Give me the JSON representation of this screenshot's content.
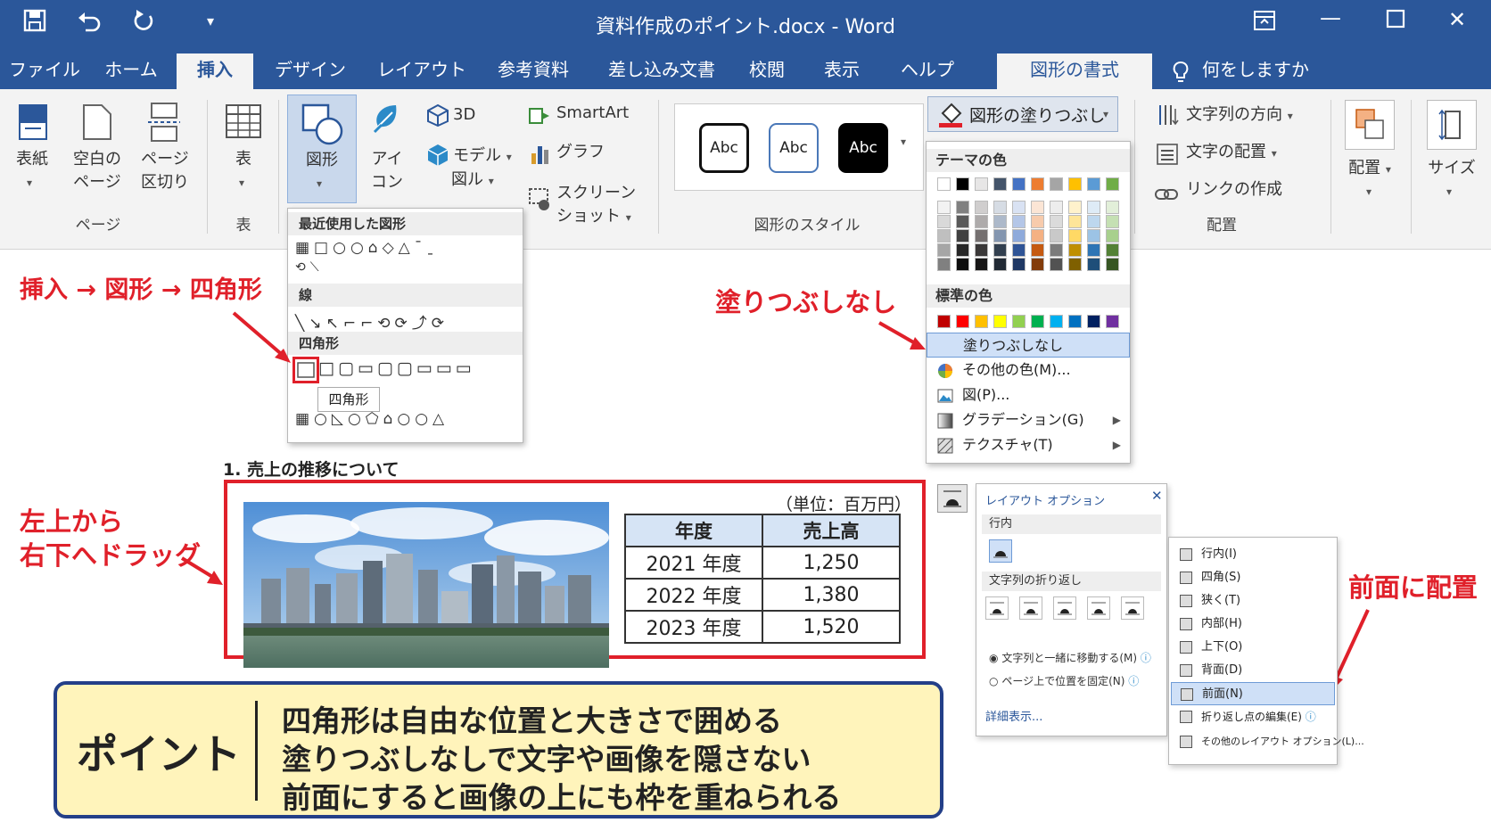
{
  "titlebar": {
    "title": "資料作成のポイント.docx  -  Word",
    "quick_access": [
      "save-icon",
      "undo-icon",
      "redo-icon",
      "customize-icon"
    ],
    "window_controls": [
      "ribbon-display-icon",
      "minimize-icon",
      "maximize-icon",
      "close-icon"
    ]
  },
  "tabs": [
    "ファイル",
    "ホーム",
    "挿入",
    "デザイン",
    "レイアウト",
    "参考資料",
    "差し込み文書",
    "校閲",
    "表示",
    "ヘルプ",
    "図形の書式",
    "何をしますか"
  ],
  "ribbon": {
    "cover": "表紙",
    "blank_page_1": "空白の",
    "blank_page_2": "ページ",
    "page_break_1": "ページ",
    "page_break_2": "区切り",
    "group_pages": "ページ",
    "table": "表",
    "group_table": "表",
    "shapes": "図形",
    "icons_1": "アイ",
    "icons_2": "コン",
    "threed": "3D",
    "model_1": "モデル",
    "model_2": "図ル",
    "smartart": "SmartArt",
    "graph": "グラフ",
    "screenshot_1": "スクリーン",
    "screenshot_2": "ショット",
    "style_samples": [
      "Abc",
      "Abc",
      "Abc"
    ],
    "group_styles": "図形のスタイル",
    "fill_button": "図形の塗りつぶし",
    "text_direction": "文字列の方向",
    "text_align": "文字の配置",
    "create_link": "リンクの作成",
    "group_text": "配置",
    "arrange": "配置",
    "size": "サイズ"
  },
  "shapes_pane": {
    "recent": "最近使用した図形",
    "lines": "線",
    "rectangles": "四角形",
    "recent_row1": "▦□○○⌂◇△ˉˍ",
    "recent_row2": "⟲⟍",
    "lines_row": "╲↘↖⌐⌐⟲⟳⤴⟳",
    "rect_row": "□▢▭▢▢▭▭▭",
    "tooltip": "四角形",
    "basic_row": "▦○◺○⬠⌂○○△"
  },
  "fill_pane": {
    "theme_colors": "テーマの色",
    "standard_colors": "標準の色",
    "theme_top": [
      "#ffffff",
      "#000000",
      "#e7e6e6",
      "#44546a",
      "#4472c4",
      "#ed7d31",
      "#a5a5a5",
      "#ffc000",
      "#5b9bd5",
      "#70ad47"
    ],
    "theme_shades": [
      [
        "#f2f2f2",
        "#808080",
        "#d0cece",
        "#d6dce4",
        "#d9e2f3",
        "#fbe5d5",
        "#ededed",
        "#fff2cc",
        "#deebf6",
        "#e2efd9"
      ],
      [
        "#d9d9d9",
        "#595959",
        "#aeabab",
        "#adb9ca",
        "#b4c6e7",
        "#f7cbac",
        "#dbdbdb",
        "#fee599",
        "#bdd7ee",
        "#c5e0b3"
      ],
      [
        "#bfbfbf",
        "#404040",
        "#757070",
        "#8496b0",
        "#8eaadb",
        "#f4b183",
        "#c9c9c9",
        "#ffd965",
        "#9cc3e5",
        "#a8d08d"
      ],
      [
        "#a6a6a6",
        "#262626",
        "#3a3838",
        "#323f4f",
        "#2f5496",
        "#c55a11",
        "#7b7b7b",
        "#bf8f00",
        "#2e75b5",
        "#538135"
      ],
      [
        "#808080",
        "#0d0d0d",
        "#171616",
        "#222a35",
        "#1f3864",
        "#833c0b",
        "#525252",
        "#7f6000",
        "#1e4e79",
        "#375623"
      ]
    ],
    "standard": [
      "#c00000",
      "#ff0000",
      "#ffc000",
      "#ffff00",
      "#92d050",
      "#00b050",
      "#00b0f0",
      "#0070c0",
      "#002060",
      "#7030a0"
    ],
    "no_fill": "塗りつぶしなし",
    "more_colors": "その他の色(M)...",
    "picture": "図(P)...",
    "gradient": "グラデーション(G)",
    "texture": "テクスチャ(T)"
  },
  "annotations": {
    "insert_path": "挿入 → 図形 → 四角形",
    "no_fill": "塗りつぶしなし",
    "drag_1": "左上から",
    "drag_2": "右下へドラッグ",
    "front": "前面に配置"
  },
  "document": {
    "heading": "1. 売上の推移について",
    "unit": "（単位：百万円）",
    "table": {
      "headers": [
        "年度",
        "売上高"
      ],
      "rows": [
        [
          "2021 年度",
          "1,250"
        ],
        [
          "2022 年度",
          "1,380"
        ],
        [
          "2023 年度",
          "1,520"
        ]
      ]
    }
  },
  "point_box": {
    "label": "ポイント",
    "lines": [
      "四角形は自由な位置と大きさで囲める",
      "塗りつぶしなしで文字や画像を隠さない",
      "前面にすると画像の上にも枠を重ねられる"
    ]
  },
  "layout_options": {
    "title": "レイアウト オプション",
    "inline": "行内",
    "wrap": "文字列の折り返し",
    "move_with_text": "文字列と一緒に移動する(M)",
    "fix_position": "ページ上で位置を固定(N)",
    "details": "詳細表示..."
  },
  "wrap_menu": [
    "行内(I)",
    "四角(S)",
    "狭く(T)",
    "内部(H)",
    "上下(O)",
    "背面(D)",
    "前面(N)",
    "折り返し点の編集(E)",
    "その他のレイアウト オプション(L)..."
  ]
}
